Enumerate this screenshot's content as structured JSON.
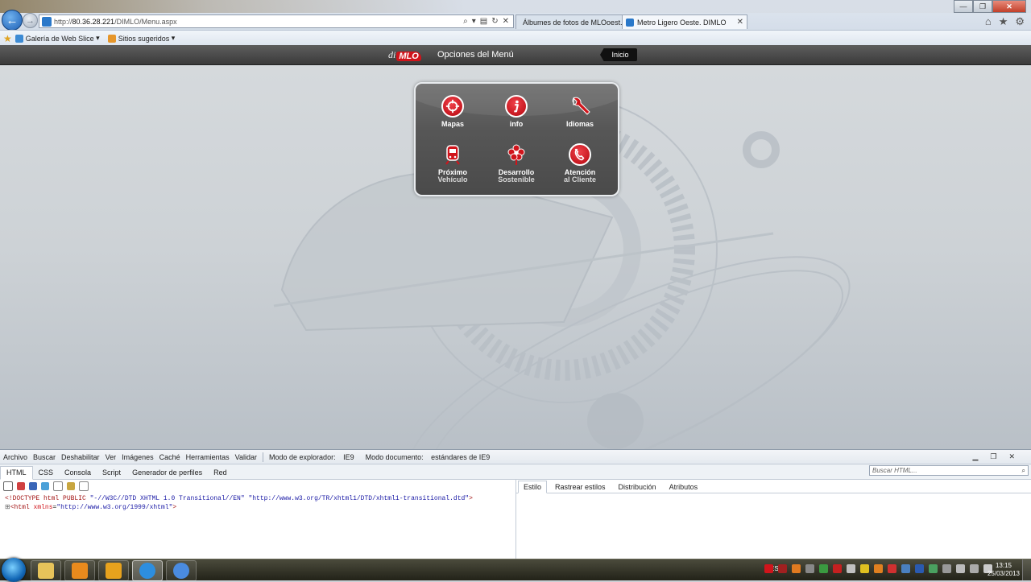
{
  "browser": {
    "url_prefix": "http://",
    "url_host": "80.36.28.221",
    "url_path": "/DIMLO/Menu.aspx",
    "tabs": [
      {
        "label": "Álbumes de fotos de MLOoest...",
        "icon_color": "#d2378e"
      },
      {
        "label": "Metro Ligero Oeste. DIMLO",
        "icon_color": "#2a78c9"
      }
    ],
    "favorites": [
      {
        "label": "Galería de Web Slice",
        "icon_color": "#3d8bd4"
      },
      {
        "label": "Sitios sugeridos",
        "icon_color": "#e6962a"
      }
    ]
  },
  "header": {
    "logo_d": "di",
    "logo_mlo": "MLO",
    "title": "Opciones del Menú",
    "home_button": "Inicio"
  },
  "menu": [
    {
      "line1": "Mapas",
      "line2": "",
      "icon": "compass-icon"
    },
    {
      "line1": "info",
      "line2": "",
      "icon": "info-icon"
    },
    {
      "line1": "Idiomas",
      "line2": "",
      "icon": "wrench-icon"
    },
    {
      "line1": "Próximo",
      "line2": "Vehículo",
      "icon": "tram-icon"
    },
    {
      "line1": "Desarrollo",
      "line2": "Sostenible",
      "icon": "flower-icon"
    },
    {
      "line1": "Atención",
      "line2": "al Cliente",
      "icon": "phone-icon"
    }
  ],
  "devtools": {
    "menu": [
      "Archivo",
      "Buscar",
      "Deshabilitar",
      "Ver",
      "Imágenes",
      "Caché",
      "Herramientas",
      "Validar"
    ],
    "browser_mode_label": "Modo de explorador:",
    "browser_mode_value": "IE9",
    "document_mode_label": "Modo documento:",
    "document_mode_value": "estándares de IE9",
    "tabs": [
      "HTML",
      "CSS",
      "Consola",
      "Script",
      "Generador de perfiles",
      "Red"
    ],
    "search_placeholder": "Buscar HTML...",
    "style_tabs": [
      "Estilo",
      "Rastrear estilos",
      "Distribución",
      "Atributos"
    ],
    "code": {
      "doctype_tag": "<!DOCTYPE html PUBLIC ",
      "doctype_val1": "\"-//W3C//DTD XHTML 1.0 Transitional//EN\"",
      "doctype_val2": " \"http://www.w3.org/TR/xhtml1/DTD/xhtml1-transitional.dtd\"",
      "doctype_end": ">",
      "html_tag": "<html ",
      "html_attr": "xmlns",
      "html_eq": "=",
      "html_val": "\"http://www.w3.org/1999/xhtml\"",
      "html_end": ">"
    }
  },
  "taskbar": {
    "language": "ES",
    "time": "13:15",
    "date": "25/03/2013",
    "apps": [
      {
        "name": "explorer",
        "color": "#e7c35a"
      },
      {
        "name": "media-player",
        "color": "#e98a1d"
      },
      {
        "name": "outlook",
        "color": "#e7a21d"
      },
      {
        "name": "internet-explorer",
        "color": "#2d8ee0"
      },
      {
        "name": "itunes",
        "color": "#4a8be0"
      }
    ]
  },
  "colors": {
    "accent_red": "#d0141b",
    "panel_gray": "#575757"
  }
}
